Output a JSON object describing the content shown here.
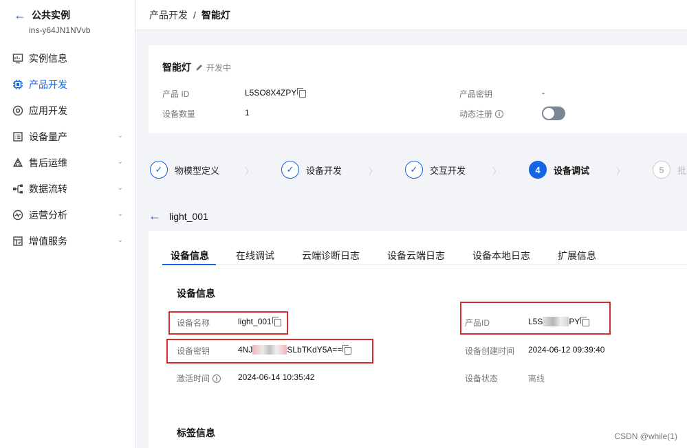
{
  "sidebar": {
    "title": "公共实例",
    "subtitle": "ins-y64JN1NVvb",
    "items": [
      {
        "label": "实例信息",
        "icon": "monitor-icon",
        "active": false,
        "expandable": false
      },
      {
        "label": "产品开发",
        "icon": "chip-icon",
        "active": true,
        "expandable": false
      },
      {
        "label": "应用开发",
        "icon": "app-ring-icon",
        "active": false,
        "expandable": false
      },
      {
        "label": "设备量产",
        "icon": "list-icon",
        "active": false,
        "expandable": true
      },
      {
        "label": "售后运维",
        "icon": "tools-icon",
        "active": false,
        "expandable": true
      },
      {
        "label": "数据流转",
        "icon": "flow-icon",
        "active": false,
        "expandable": true
      },
      {
        "label": "运营分析",
        "icon": "pulse-icon",
        "active": false,
        "expandable": true
      },
      {
        "label": "增值服务",
        "icon": "package-icon",
        "active": false,
        "expandable": true
      }
    ]
  },
  "breadcrumb": {
    "parent": "产品开发",
    "separator": "/",
    "current": "智能灯"
  },
  "product": {
    "name": "智能灯",
    "status": "开发中",
    "id_label": "产品 ID",
    "id_value": "L5SO8X4ZPY",
    "count_label": "设备数量",
    "count_value": "1",
    "secret_label": "产品密钥",
    "secret_value": "-",
    "dynreg_label": "动态注册",
    "dynreg_enabled": false
  },
  "steps": [
    {
      "num": "1",
      "label": "物模型定义",
      "state": "done"
    },
    {
      "num": "2",
      "label": "设备开发",
      "state": "done"
    },
    {
      "num": "3",
      "label": "交互开发",
      "state": "done"
    },
    {
      "num": "4",
      "label": "设备调试",
      "state": "current"
    },
    {
      "num": "5",
      "label": "批",
      "state": "future"
    }
  ],
  "device": {
    "name": "light_001",
    "tabs": [
      "设备信息",
      "在线调试",
      "云端诊断日志",
      "设备云端日志",
      "设备本地日志",
      "扩展信息"
    ],
    "active_tab": 0,
    "section_info": "设备信息",
    "section_tags": "标签信息",
    "fields": {
      "name_label": "设备名称",
      "name_value": "light_001",
      "secret_label": "设备密钥",
      "secret_prefix": "4NJ",
      "secret_suffix": "SLbTKdY5A==",
      "activated_label": "激活时间",
      "activated_value": "2024-06-14 10:35:42",
      "pid_label": "产品ID",
      "pid_prefix": "L5S",
      "pid_suffix": "PY",
      "created_label": "设备创建时间",
      "created_value": "2024-06-12 09:39:40",
      "status_label": "设备状态",
      "status_value": "离线"
    }
  },
  "watermark": "CSDN @while(1)",
  "colors": {
    "accent": "#1464e6",
    "highlight": "#d92b2b"
  }
}
